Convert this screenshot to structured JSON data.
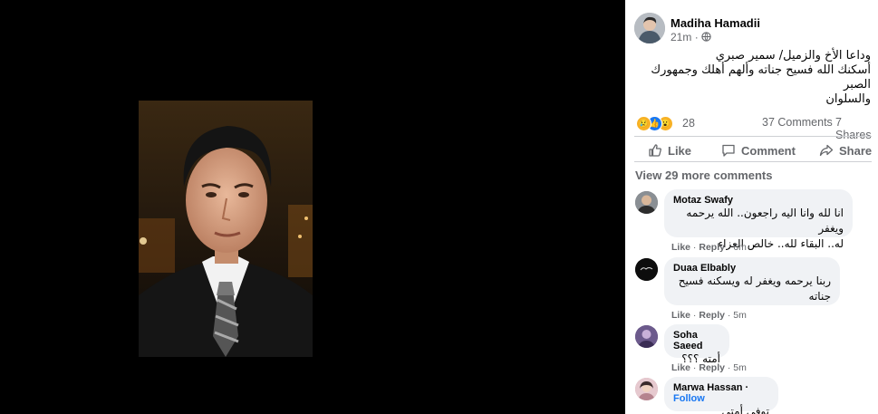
{
  "post": {
    "author": "Madiha Hamadii",
    "time": "21m",
    "globe_icon": "globe-icon",
    "text_line1": "وداعا الأخ والزميل/ سمير صبري",
    "text_line2": "أسكنك الله فسيح جناته وألهم أهلك وجمهورك الصبر",
    "text_line3": "والسلوان",
    "reaction_count": "28",
    "comments_count": "37 Comments",
    "shares_count": "7 Shares"
  },
  "actions": {
    "like": "Like",
    "comment": "Comment",
    "share": "Share"
  },
  "view_more": "View 29 more comments",
  "comments": [
    {
      "name": "Motaz Swafy",
      "line1": "انا لله وانا اليه راجعون.. الله يرحمه ويغفر",
      "line2": "له.. البقاء لله.. خالص العزاء",
      "like": "Like",
      "reply": "Reply",
      "time": "6m"
    },
    {
      "name": "Duaa Elbably",
      "line1": "ربنا يرحمه ويغفر له ويسكنه فسيح",
      "line2": "جناته",
      "like": "Like",
      "reply": "Reply",
      "time": "5m"
    },
    {
      "name": "Soha Saeed",
      "line1": "أمته ؟؟؟",
      "like": "Like",
      "reply": "Reply",
      "time": "5m"
    },
    {
      "name": "Marwa Hassan",
      "follow": "Follow",
      "line1": "توفي أمتي"
    }
  ],
  "colors": {
    "viewer_bg": "#000000",
    "panel_bg": "#ffffff",
    "secondary_text": "#65676b",
    "bubble_bg": "#f0f2f5",
    "link_blue": "#1877f2"
  }
}
